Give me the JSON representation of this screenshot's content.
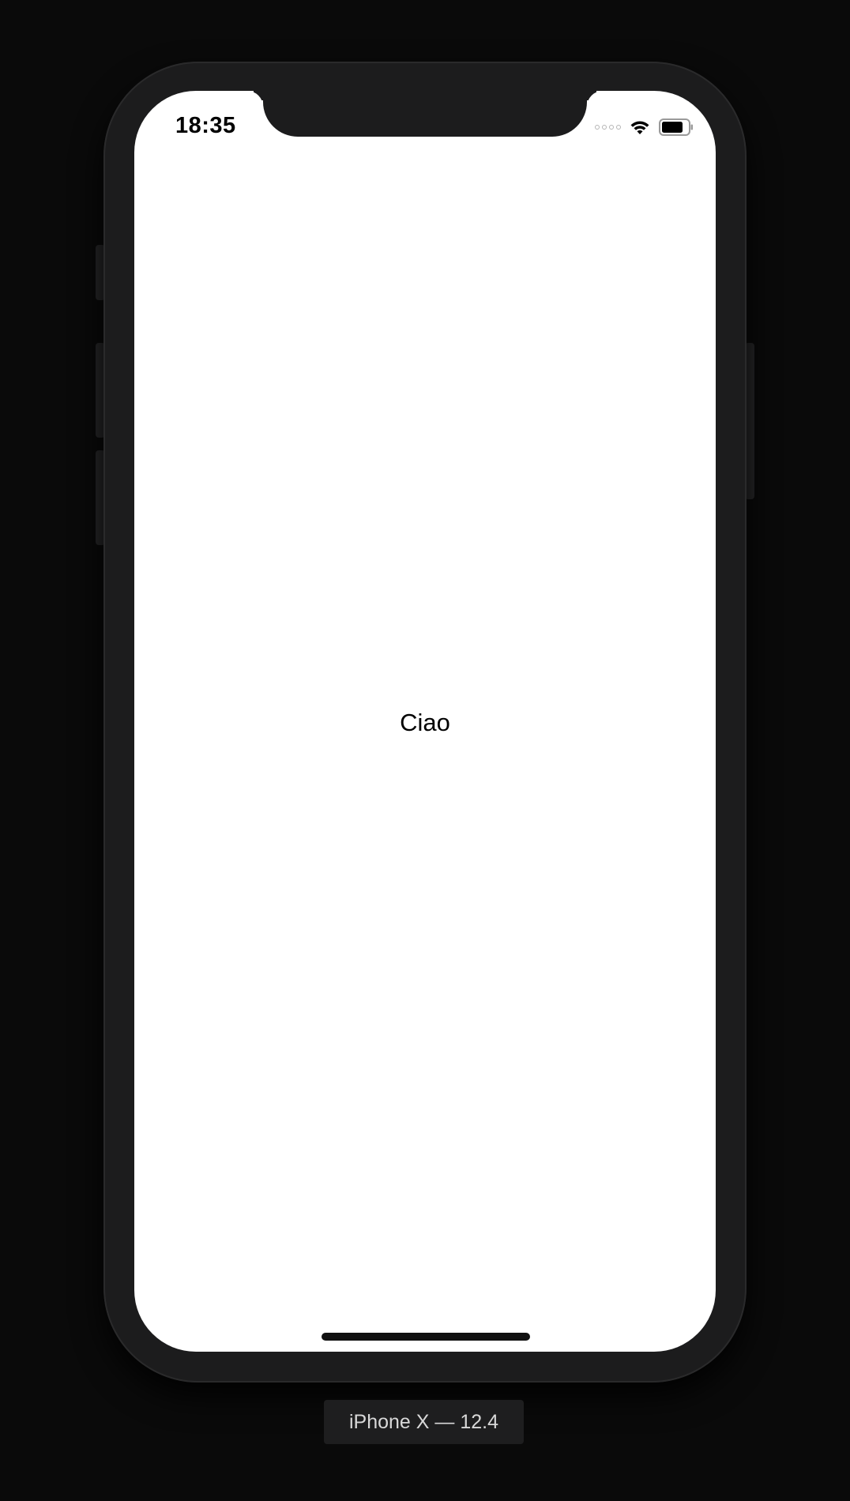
{
  "simulator": {
    "device_label": "iPhone X — 12.4"
  },
  "status_bar": {
    "time": "18:35",
    "icons": [
      "signal-dots-icon",
      "wifi-icon",
      "battery-icon"
    ]
  },
  "screen": {
    "center_text": "Ciao",
    "background": "#ffffff"
  },
  "colors": {
    "frame": "#1c1c1d",
    "backdrop": "#0a0a0a",
    "text": "#000000"
  }
}
